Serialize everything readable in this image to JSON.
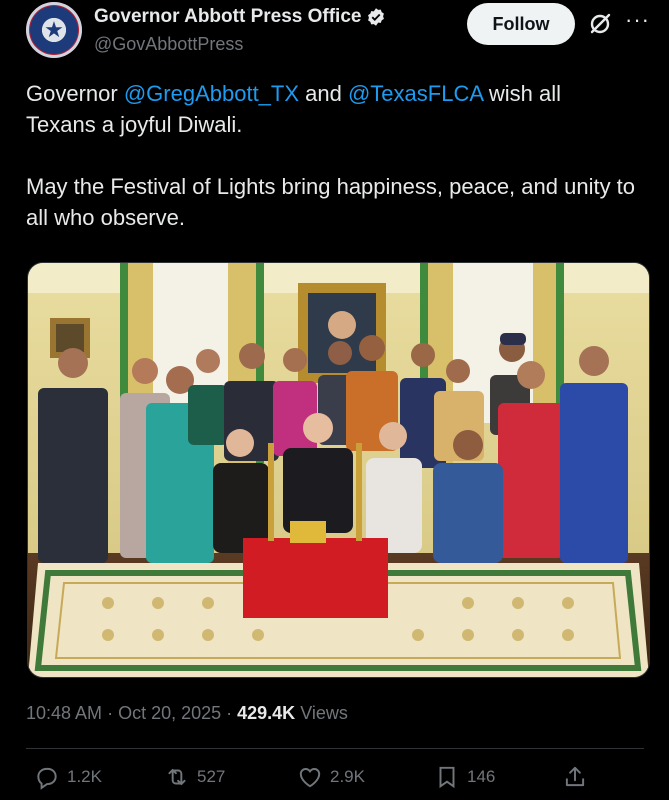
{
  "author": {
    "name": "Governor Abbott Press Office",
    "handle": "@GovAbbottPress"
  },
  "header": {
    "follow_label": "Follow"
  },
  "post": {
    "line1_prefix": "Governor ",
    "mention1": "@GregAbbott_TX",
    "line1_mid": " and ",
    "mention2": "@TexasFLCA",
    "line1_suffix": " wish all Texans a joyful Diwali.",
    "paragraph2": "May the Festival of Lights bring happiness, peace, and unity to all who observe."
  },
  "meta": {
    "time": "10:48 AM",
    "sep1": " · ",
    "date": "Oct 20, 2025",
    "sep2": " · ",
    "views_count": "429.4K",
    "views_label": " Views"
  },
  "actions": {
    "replies": "1.2K",
    "reposts": "527",
    "likes": "2.9K",
    "bookmarks": "146"
  },
  "icons": [
    "verified-icon",
    "grok-icon",
    "more-icon",
    "reply-icon",
    "repost-icon",
    "like-icon",
    "bookmark-icon",
    "share-icon"
  ],
  "colors": {
    "accent": "#1d9bf0",
    "text": "#e7e9ea",
    "muted": "#71767b",
    "background": "#000000"
  }
}
